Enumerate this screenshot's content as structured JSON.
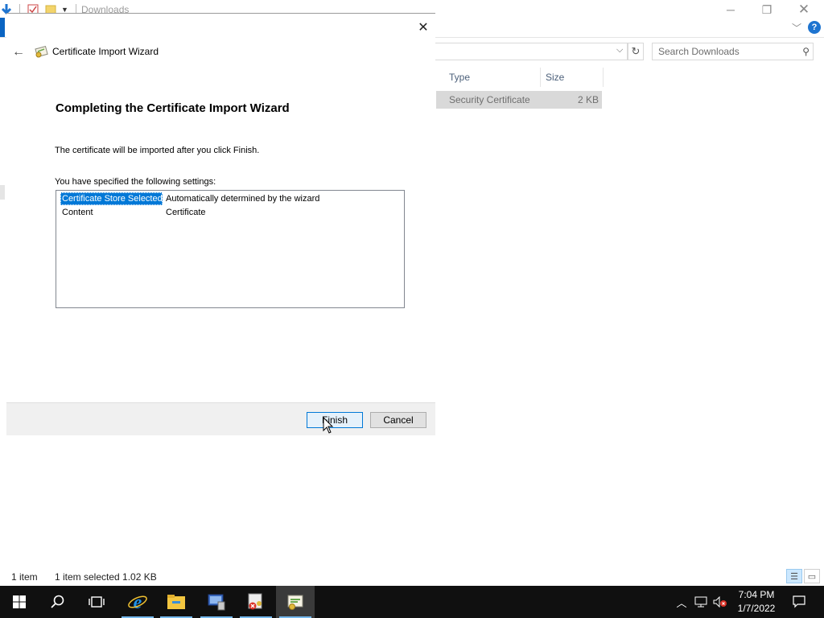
{
  "explorer": {
    "title": "Downloads",
    "search": {
      "placeholder": "Search Downloads"
    },
    "columns": {
      "type": "Type",
      "size": "Size"
    },
    "file": {
      "type": "Security Certificate",
      "size": "2 KB"
    },
    "status": {
      "items": "1 item",
      "selected": "1 item selected  1.02 KB"
    }
  },
  "wizard": {
    "title": "Certificate Import Wizard",
    "heading": "Completing the Certificate Import Wizard",
    "description": "The certificate will be imported after you click Finish.",
    "settings_label": "You have specified the following settings:",
    "settings": [
      {
        "key": "Certificate Store Selected",
        "value": "Automatically determined by the wizard"
      },
      {
        "key": "Content",
        "value": "Certificate"
      }
    ],
    "finish_label": "Finish",
    "cancel_label": "Cancel"
  },
  "taskbar": {
    "time": "7:04 PM",
    "date": "1/7/2022"
  },
  "colors": {
    "accent": "#0078d7",
    "taskbar": "#101010",
    "selection": "#0078d7"
  },
  "icons": [
    "windows-start-icon",
    "search-icon",
    "task-view-icon",
    "internet-explorer-icon",
    "file-explorer-icon",
    "server-manager-icon",
    "certificate-manager-icon",
    "certificate-wizard-icon",
    "chevron-up-icon",
    "network-icon",
    "volume-muted-icon",
    "notification-icon"
  ]
}
